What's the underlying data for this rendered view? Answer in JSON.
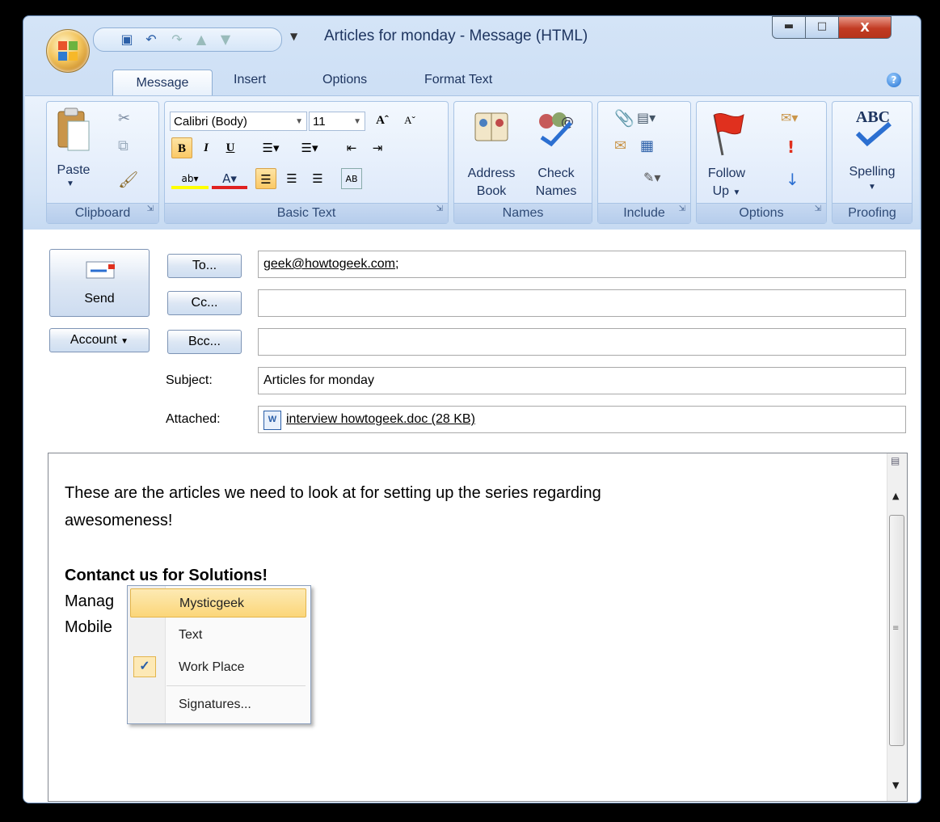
{
  "window": {
    "title": "Articles for monday - Message (HTML)"
  },
  "tabs": [
    "Message",
    "Insert",
    "Options",
    "Format Text"
  ],
  "ribbon": {
    "clipboard": {
      "label": "Clipboard",
      "paste": "Paste"
    },
    "basic_text": {
      "label": "Basic Text",
      "font": "Calibri (Body)",
      "size": "11"
    },
    "names": {
      "label": "Names",
      "address_book": [
        "Address",
        "Book"
      ],
      "check_names": [
        "Check",
        "Names"
      ]
    },
    "include": {
      "label": "Include"
    },
    "options": {
      "label": "Options",
      "follow_up": [
        "Follow",
        "Up"
      ]
    },
    "proofing": {
      "label": "Proofing",
      "spelling": "Spelling",
      "abc": "ABC"
    }
  },
  "compose": {
    "send": "Send",
    "account": "Account",
    "to_btn": "To...",
    "cc_btn": "Cc...",
    "bcc_btn": "Bcc...",
    "to_value": "geek@howtogeek.com;",
    "cc_value": "",
    "bcc_value": "",
    "subject_label": "Subject:",
    "subject_value": "Articles for monday",
    "attached_label": "Attached:",
    "attachment": "interview howtogeek.doc (28 KB)"
  },
  "message": {
    "line1": "These are the articles we need to look at for setting up the series regarding",
    "line2": "awesomeness!",
    "sig_title": "Contanct us for Solutions!",
    "sig_line1": "Manag",
    "sig_line2": "Mobile"
  },
  "signature_menu": {
    "items": [
      "Mysticgeek",
      "Text",
      "Work Place",
      "Signatures..."
    ],
    "checked": "Work Place",
    "highlighted": "Mysticgeek"
  },
  "colors": {
    "accent": "#fbd679",
    "title_text": "#1e3560",
    "close": "#c23b23"
  }
}
